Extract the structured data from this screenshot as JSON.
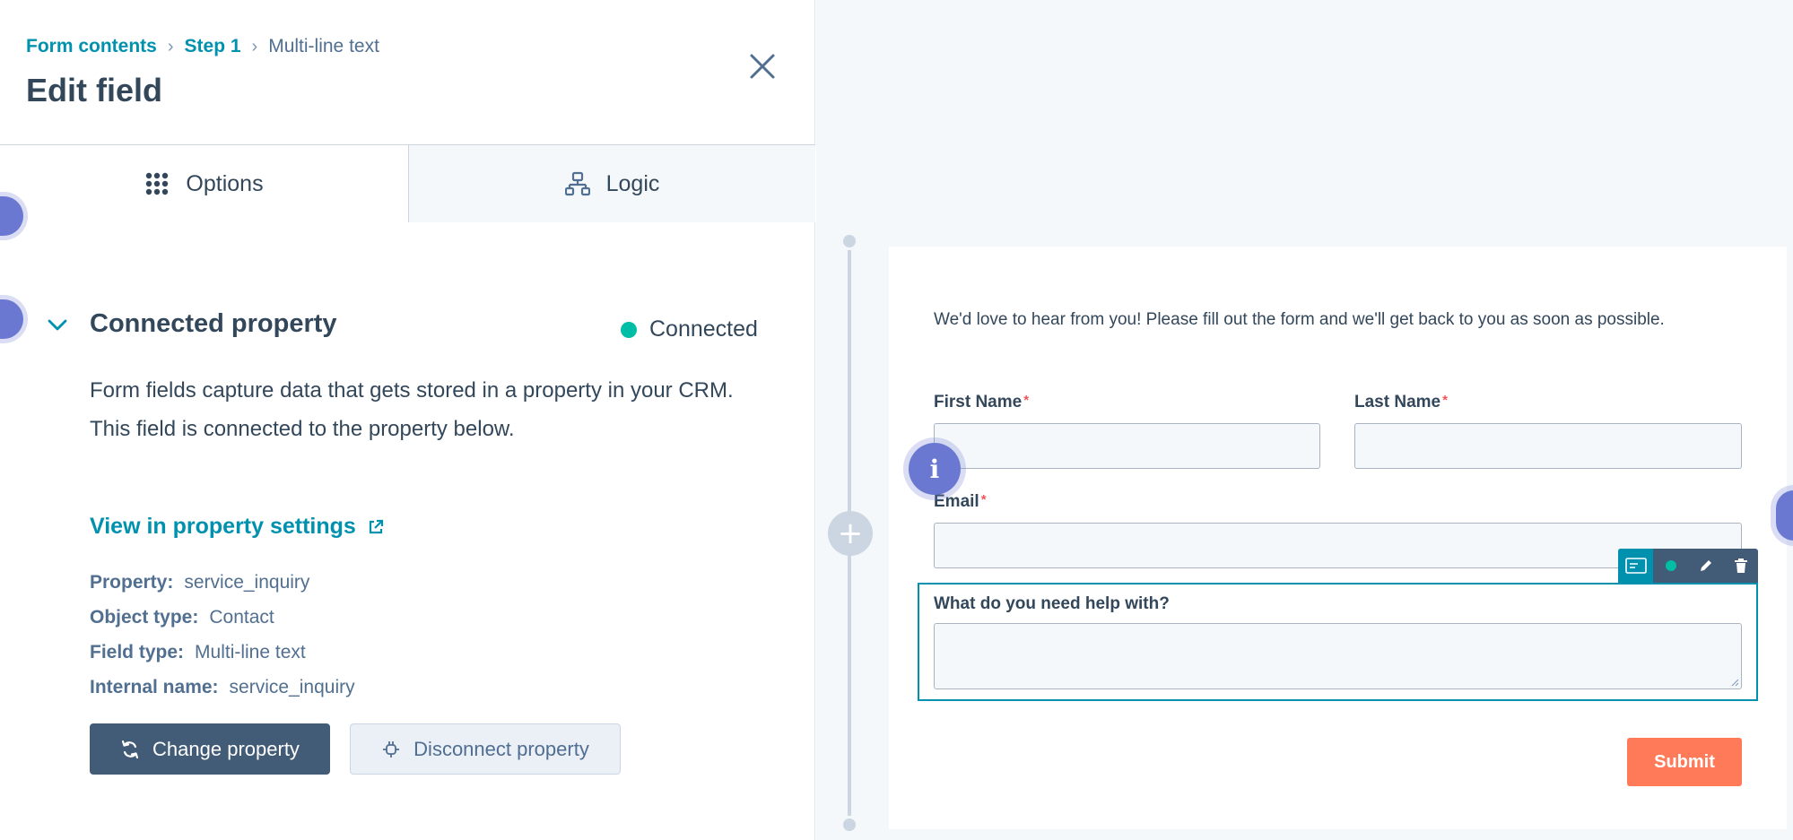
{
  "breadcrumb": {
    "items": [
      "Form contents",
      "Step 1"
    ],
    "current": "Multi-line text"
  },
  "panel": {
    "title": "Edit field"
  },
  "tabs": [
    {
      "label": "Options",
      "icon": "grid-icon",
      "active": true
    },
    {
      "label": "Logic",
      "icon": "logic-tree-icon",
      "active": false
    }
  ],
  "connected_property": {
    "title": "Connected property",
    "status": "Connected",
    "status_color": "#00bda5",
    "description_line1": "Form fields capture data that gets stored in a property in your CRM.",
    "description_line2": "This field is connected to the property below.",
    "link_label": "View in property settings",
    "details": [
      {
        "key": "Property:",
        "value": "service_inquiry"
      },
      {
        "key": "Object type:",
        "value": "Contact"
      },
      {
        "key": "Field type:",
        "value": "Multi-line text"
      },
      {
        "key": "Internal name:",
        "value": "service_inquiry"
      }
    ],
    "change_button": "Change property",
    "disconnect_button": "Disconnect property"
  },
  "form_preview": {
    "intro": "We'd love to hear from you! Please fill out the form and we'll get back to you as soon as possible.",
    "fields": {
      "first_name": {
        "label": "First Name",
        "required_mark": "*"
      },
      "last_name": {
        "label": "Last Name",
        "required_mark": "*"
      },
      "email": {
        "label": "Email",
        "required_mark": "*"
      },
      "help": {
        "label": "What do you need help with?"
      }
    },
    "info_bubble": "i",
    "add_symbol": "+",
    "submit_label": "Submit",
    "submit_color": "#ff7a59",
    "toolbar_icons": [
      "field-card-icon",
      "dot-icon",
      "pencil-icon",
      "trash-icon"
    ]
  },
  "colors": {
    "accent": "#0091ae",
    "primary_button": "#425b76",
    "selection": "#0091ae",
    "bubble": "#6a78d1"
  }
}
